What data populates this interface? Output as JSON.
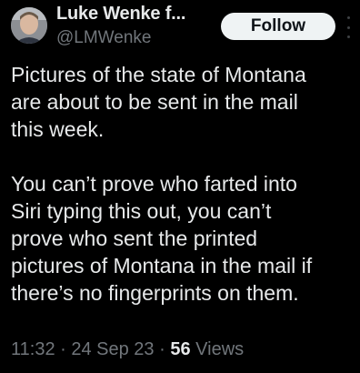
{
  "author": {
    "name": "Luke Wenke f...",
    "handle": "@LMWenke"
  },
  "header": {
    "follow_label": "Follow"
  },
  "tweet": {
    "paragraphs": [
      "Pictures of the state of Montana\nare about to be sent in the mail\nthis week.",
      "You can’t prove who farted into\nSiri typing this out, you can’t\nprove who sent the printed\npictures of Montana in the mail if\nthere’s no fingerprints on them."
    ]
  },
  "meta": {
    "time": "11:32",
    "separator": " · ",
    "date": "24 Sep 23",
    "views_count": "56",
    "views_label": "Views"
  },
  "colors": {
    "background": "#000000",
    "text": "#e7e9ea",
    "secondary_text": "#71767b",
    "follow_button_bg": "#eff3f4",
    "follow_button_text": "#0f1419"
  },
  "icons": {
    "more": "more-vertical-icon"
  }
}
